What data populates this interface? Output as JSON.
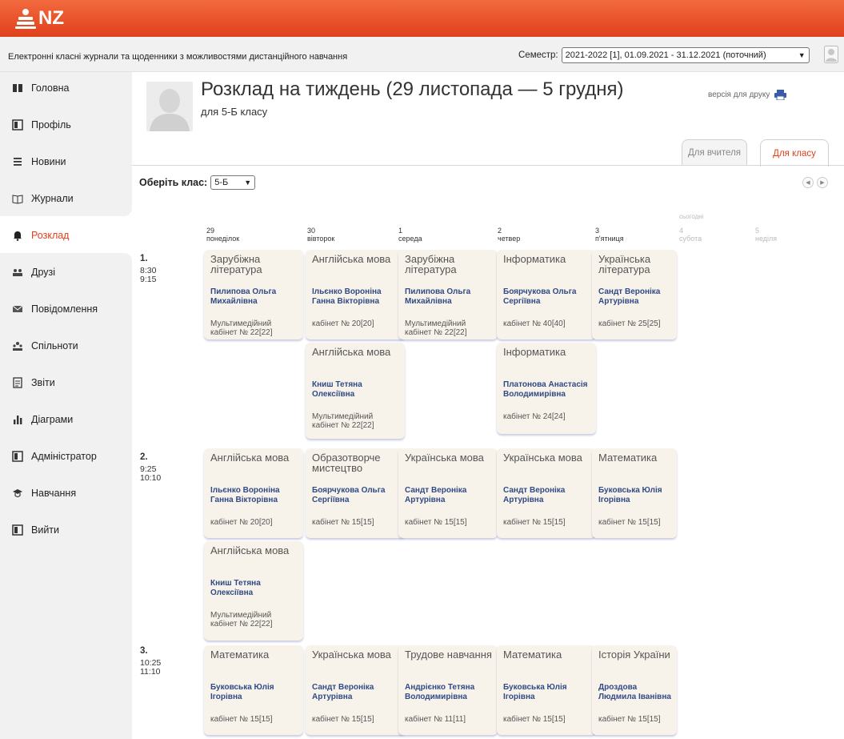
{
  "header": {
    "logo_text": "NZ"
  },
  "subbar": {
    "subtitle": "Електронні класні журнали та щоденники з можливостями дистанційного навчання",
    "semester_label": "Семестр:",
    "semester_value": "2021-2022 [1], 01.09.2021 - 31.12.2021 (поточний)"
  },
  "sidebar": {
    "items": [
      {
        "label": "Головна",
        "icon": "grid-icon"
      },
      {
        "label": "Профіль",
        "icon": "profile-icon"
      },
      {
        "label": "Новини",
        "icon": "menu-icon"
      },
      {
        "label": "Журнали",
        "icon": "book-icon"
      },
      {
        "label": "Розклад",
        "icon": "bell-icon"
      },
      {
        "label": "Друзі",
        "icon": "friends-icon"
      },
      {
        "label": "Повідомлення",
        "icon": "envelope-icon"
      },
      {
        "label": "Спільноти",
        "icon": "community-icon"
      },
      {
        "label": "Звіти",
        "icon": "report-icon"
      },
      {
        "label": "Діаграми",
        "icon": "chart-icon"
      },
      {
        "label": "Адміністратор",
        "icon": "admin-icon"
      },
      {
        "label": "Навчання",
        "icon": "graduation-icon"
      },
      {
        "label": "Вийти",
        "icon": "logout-icon"
      }
    ],
    "active": "Розклад"
  },
  "main": {
    "title": "Розклад на тиждень (29 листопада — 5 грудня)",
    "subtitle": "для 5-Б класу",
    "print_label": "версія для друку",
    "tabs": [
      {
        "label": "Для вчителя",
        "active": false
      },
      {
        "label": "Для класу",
        "active": true
      }
    ],
    "class_picker_label": "Оберіть клас:",
    "class_value": "5-Б",
    "today_label": "сьогодні"
  },
  "days": [
    {
      "num": "29",
      "name": "понеділок"
    },
    {
      "num": "30",
      "name": "вівторок"
    },
    {
      "num": "1",
      "name": "середа"
    },
    {
      "num": "2",
      "name": "четвер"
    },
    {
      "num": "3",
      "name": "п'ятниця"
    },
    {
      "num": "4",
      "name": "субота"
    },
    {
      "num": "5",
      "name": "неділя"
    }
  ],
  "lessons": [
    {
      "num": "1.",
      "start": "8:30",
      "end": "9:15"
    },
    {
      "num": "2.",
      "start": "9:25",
      "end": "10:10"
    },
    {
      "num": "3.",
      "start": "10:25",
      "end": "11:10"
    }
  ],
  "cards": [
    {
      "subject": "Зарубіжна література",
      "teacher": "Пилипова Ольга Михайлівна",
      "room": "Мультимедійний кабінет № 22[22]"
    },
    {
      "subject": "Англійська мова",
      "teacher": "Ільєнко Вороніна Ганна Вікторівна",
      "room": "кабінет № 20[20]"
    },
    {
      "subject": "Англійська мова",
      "teacher": "Книш Тетяна Олексіївна",
      "room": "Мультимедійний кабінет № 22[22]"
    },
    {
      "subject": "Зарубіжна література",
      "teacher": "Пилипова Ольга Михайлівна",
      "room": "Мультимедійний кабінет № 22[22]"
    },
    {
      "subject": "Інформатика",
      "teacher": "Боярчукова Ольга Сергіївна",
      "room": "кабінет № 40[40]"
    },
    {
      "subject": "Інформатика",
      "teacher": "Платонова Анастасія Володимирівна",
      "room": "кабінет № 24[24]"
    },
    {
      "subject": "Українська література",
      "teacher": "Сандт Вероніка Артурівна",
      "room": "кабінет № 25[25]"
    },
    {
      "subject": "Англійська мова",
      "teacher": "Ільєнко Вороніна Ганна Вікторівна",
      "room": "кабінет № 20[20]"
    },
    {
      "subject": "Англійська мова",
      "teacher": "Книш Тетяна Олексіївна",
      "room": "Мультимедійний кабінет № 22[22]"
    },
    {
      "subject": "Образотворче мистецтво",
      "teacher": "Боярчукова Ольга Сергіївна",
      "room": "кабінет № 15[15]"
    },
    {
      "subject": "Українська мова",
      "teacher": "Сандт Вероніка Артурівна",
      "room": "кабінет № 15[15]"
    },
    {
      "subject": "Українська мова",
      "teacher": "Сандт Вероніка Артурівна",
      "room": "кабінет № 15[15]"
    },
    {
      "subject": "Математика",
      "teacher": "Буковська Юлія Ігорівна",
      "room": "кабінет № 15[15]"
    },
    {
      "subject": "Математика",
      "teacher": "Буковська Юлія Ігорівна",
      "room": "кабінет № 15[15]"
    },
    {
      "subject": "Українська мова",
      "teacher": "Сандт Вероніка Артурівна",
      "room": "кабінет № 15[15]"
    },
    {
      "subject": "Трудове навчання",
      "teacher": "Андрієнко Тетяна Володимирівна",
      "room": "кабінет № 11[11]"
    },
    {
      "subject": "Математика",
      "teacher": "Буковська Юлія Ігорівна",
      "room": "кабінет № 15[15]"
    },
    {
      "subject": "Історія України",
      "teacher": "Дроздова Людмила Іванівна",
      "room": "кабінет № 15[15]"
    }
  ],
  "colors": {
    "accent": "#e0401c",
    "card_bg": "#f8f3ea",
    "teacher_text": "#2f4a86"
  }
}
